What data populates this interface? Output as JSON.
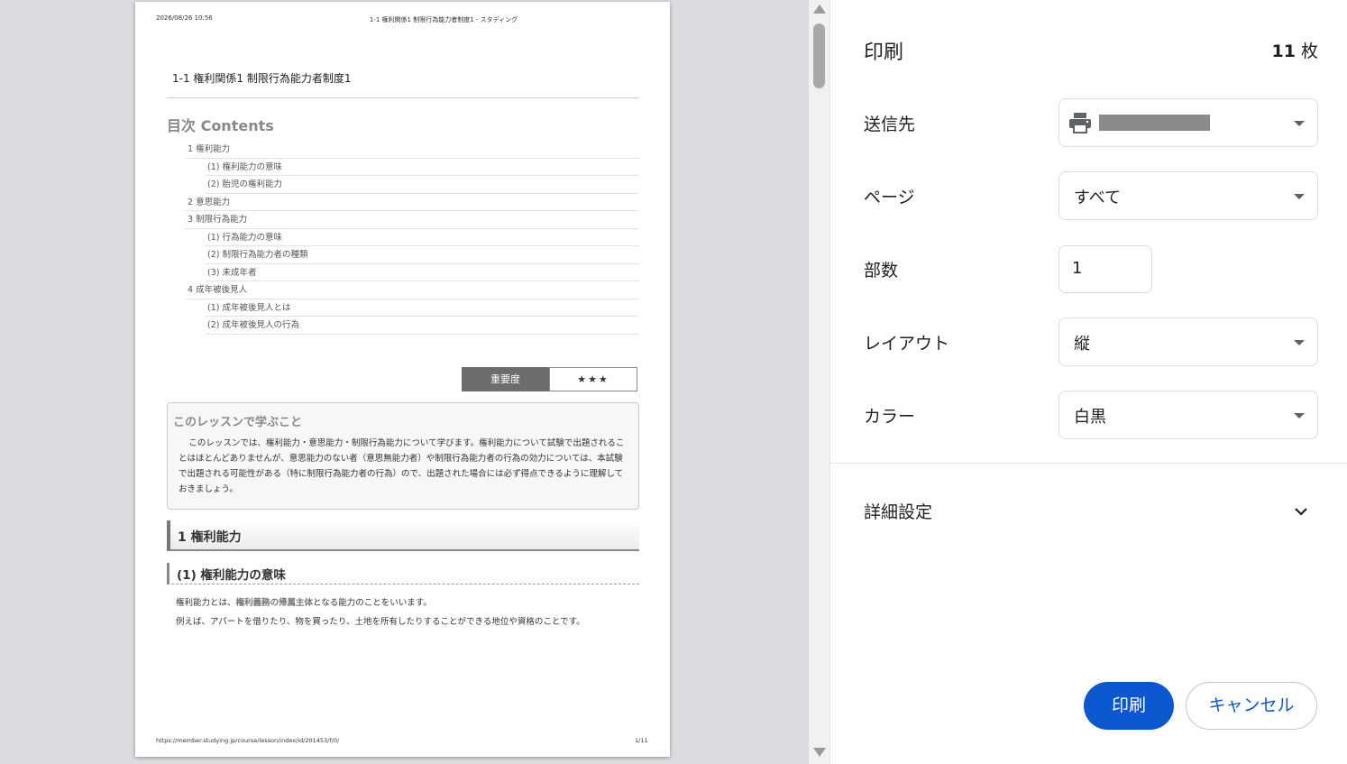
{
  "preview": {
    "header_date": "2026/08/26 10:56",
    "header_title": "1-1 権利関係1 制限行為能力者制度1 - スタディング",
    "doc_title": "1-1 権利関係1 制限行為能力者制度1",
    "toc_title": "目次 Contents",
    "toc": [
      {
        "level": 1,
        "text": "1 権利能力"
      },
      {
        "level": 2,
        "text": "(1) 権利能力の意味"
      },
      {
        "level": 2,
        "text": "(2) 胎児の権利能力"
      },
      {
        "level": 1,
        "text": "2 意思能力"
      },
      {
        "level": 1,
        "text": "3 制限行為能力"
      },
      {
        "level": 2,
        "text": "(1) 行為能力の意味"
      },
      {
        "level": 2,
        "text": "(2) 制限行為能力者の種類"
      },
      {
        "level": 2,
        "text": "(3) 未成年者"
      },
      {
        "level": 1,
        "text": "4 成年被後見人"
      },
      {
        "level": 2,
        "text": "(1) 成年被後見人とは"
      },
      {
        "level": 2,
        "text": "(2) 成年被後見人の行為"
      }
    ],
    "importance_label": "重要度",
    "importance_stars": "★★★",
    "lesson_box_title": "このレッスンで学ぶこと",
    "lesson_box_body": "このレッスンでは、権利能力・意思能力・制限行為能力について学びます。権利能力について試験で出題されることはほとんどありませんが、意思能力のない者（意思無能力者）や制限行為能力者の行為の効力については、本試験で出題される可能性がある（特に制限行為能力者の行為）ので、出題された場合には必ず得点できるように理解しておきましょう。",
    "section1": "1 権利能力",
    "section2": "(1) 権利能力の意味",
    "para1_pre": "権利能力とは、",
    "para1_hl": "権利義務の帰属主体",
    "para1_post": "となる能力のことをいいます。",
    "para2": "例えば、アパートを借りたり、物を買ったり、土地を所有したりすることができる地位や資格のことです。",
    "footer_url": "https://member.studying.jp/course/lesson/index/id/201453/f/0/",
    "footer_page": "1/11"
  },
  "panel": {
    "title": "印刷",
    "sheet_count_num": "11",
    "sheet_count_unit": "枚",
    "destination_label": "送信先",
    "pages_label": "ページ",
    "pages_value": "すべて",
    "copies_label": "部数",
    "copies_value": "1",
    "layout_label": "レイアウト",
    "layout_value": "縦",
    "color_label": "カラー",
    "color_value": "白黒",
    "advanced_label": "詳細設定",
    "print_button": "印刷",
    "cancel_button": "キャンセル"
  },
  "colors": {
    "accent": "#0b57d0",
    "preview_bg": "#dadce0"
  }
}
